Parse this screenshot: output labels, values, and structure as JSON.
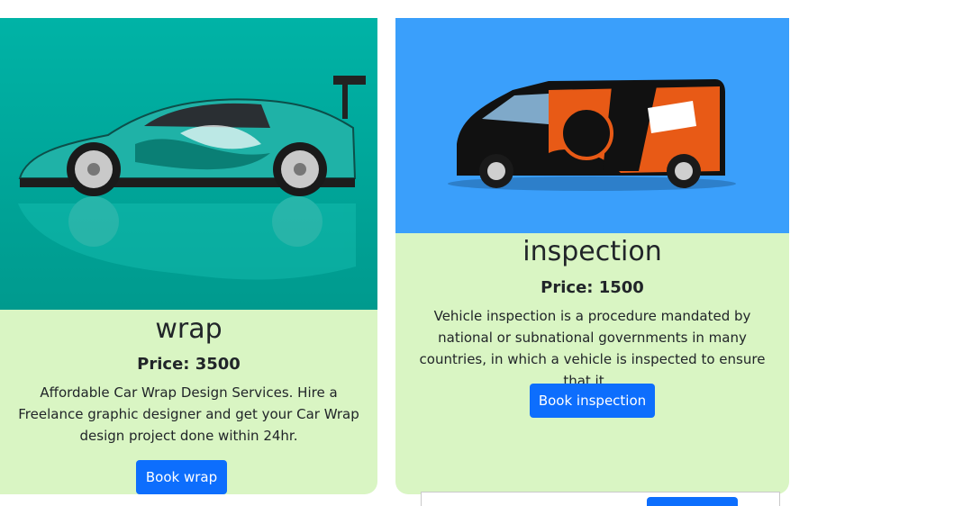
{
  "cards": [
    {
      "image_alt": "car wrap",
      "title": "wrap",
      "price": "Price: 3500",
      "description": "Affordable Car Wrap Design Services. Hire a Freelance graphic designer and get your Car Wrap design project done within 24hr.",
      "button_label": "Book wrap",
      "image_bg": "#00a69a"
    },
    {
      "image_alt": "inspection van",
      "title": "inspection",
      "price": "Price: 1500",
      "description": "Vehicle inspection is a procedure mandated by national or subnational governments in many countries, in which a vehicle is inspected to ensure that it ...",
      "button_label": "Book inspection",
      "image_bg": "#3a9ffb"
    }
  ],
  "colors": {
    "card_body": "#d9f5c3",
    "button": "#0d6efd",
    "text": "#212529"
  }
}
